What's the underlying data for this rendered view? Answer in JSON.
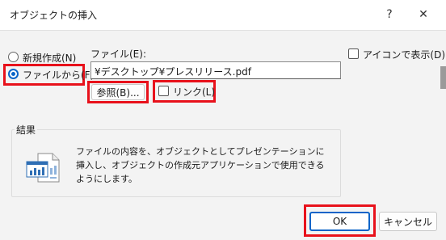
{
  "window": {
    "title": "オブジェクトの挿入",
    "help_glyph": "?",
    "close_glyph": "✕"
  },
  "options": {
    "create_new_label": "新規作成(N)",
    "from_file_label": "ファイルから(F)",
    "selected": "from_file"
  },
  "file": {
    "field_label": "ファイル(E):",
    "path_value": "¥デスクトップ¥プレスリリース.pdf",
    "browse_label": "参照(B)...",
    "link_label": "リンク(L)",
    "link_checked": false
  },
  "display_as_icon": {
    "label": "アイコンで表示(D)",
    "checked": false
  },
  "result": {
    "group_label": "結果",
    "description": "ファイルの内容を、オブジェクトとしてプレゼンテーションに挿入し、オブジェクトの作成元アプリケーションで使用できるようにします。"
  },
  "footer": {
    "ok_label": "OK",
    "cancel_label": "キャンセル"
  },
  "colors": {
    "highlight": "#e8111b",
    "accent": "#0a64c8"
  }
}
